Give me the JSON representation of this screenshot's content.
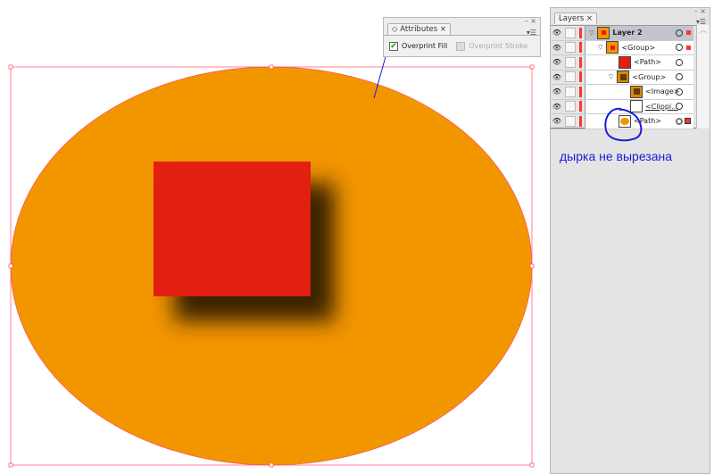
{
  "attributes_panel": {
    "tab": "Attributes",
    "overprint_fill": {
      "label": "Overprint Fill",
      "checked": true
    },
    "overprint_stroke": {
      "label": "Overprint Stroke",
      "checked": false,
      "disabled": true
    }
  },
  "layers_panel": {
    "tab": "Layers",
    "rows": [
      {
        "label": "Layer 2",
        "indent": 0,
        "expanded": true,
        "selected": true
      },
      {
        "label": "<Group>",
        "indent": 1,
        "expanded": true
      },
      {
        "label": "<Path>",
        "indent": 2
      },
      {
        "label": "<Group>",
        "indent": 2,
        "expanded": true
      },
      {
        "label": "<Image>",
        "indent": 3
      },
      {
        "label": "<Clippi...",
        "indent": 3
      },
      {
        "label": "<Path>",
        "indent": 2
      }
    ]
  },
  "annotation": "дырка не вырезана",
  "colors": {
    "ellipse": "#f29600",
    "square": "#e31f10",
    "annotation": "#1a1adc"
  }
}
